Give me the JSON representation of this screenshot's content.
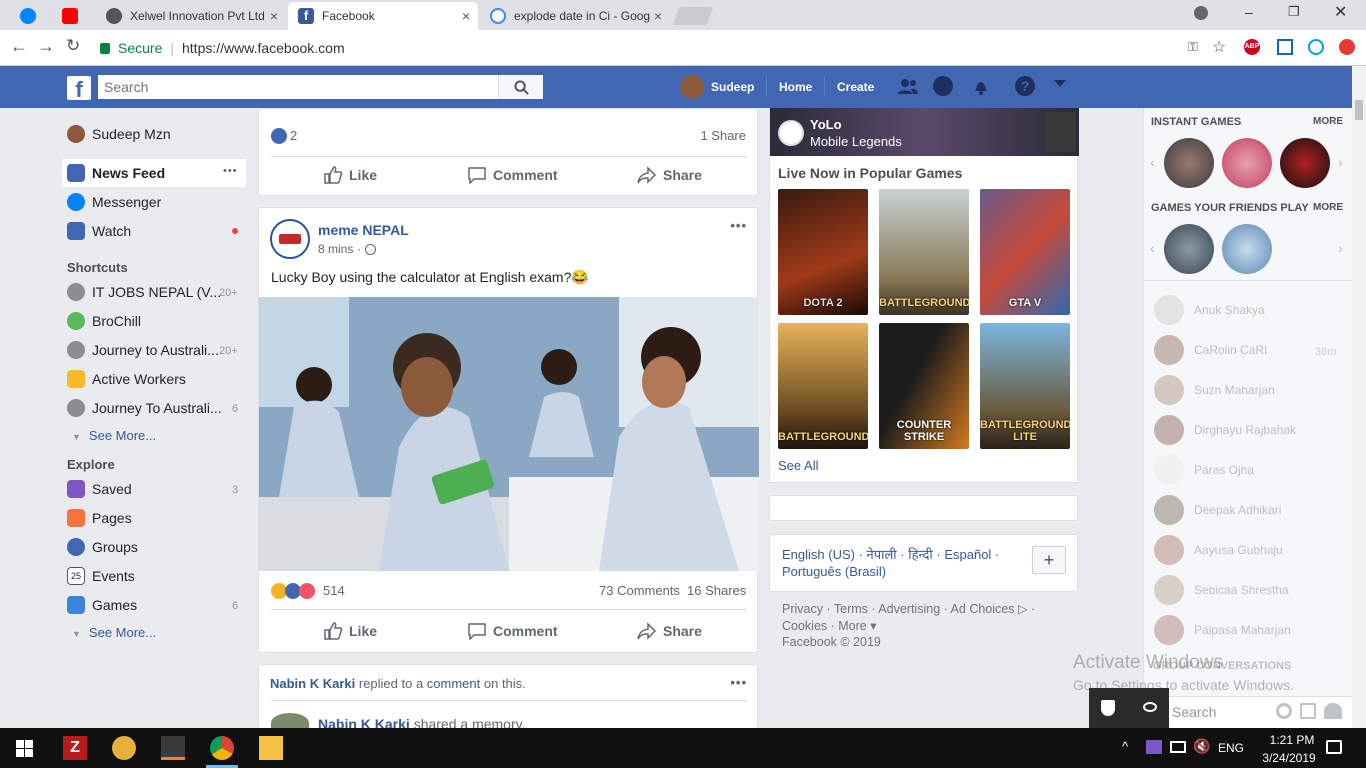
{
  "browser": {
    "tabs": [
      {
        "label": "",
        "icon": "messenger-icon"
      },
      {
        "label": "",
        "icon": "youtube-icon"
      },
      {
        "label": "Xelwel Innovation Pvt Ltd",
        "icon": "xelwel-icon"
      },
      {
        "label": "Facebook",
        "icon": "facebook-icon"
      },
      {
        "label": "explode date in Ci - Goog",
        "icon": "google-icon"
      }
    ],
    "secure_label": "Secure",
    "url": "https://www.facebook.com"
  },
  "header": {
    "search_placeholder": "Search",
    "user": "Sudeep",
    "home": "Home",
    "create": "Create"
  },
  "left_nav": {
    "profile": "Sudeep Mzn",
    "main": [
      {
        "label": "News Feed",
        "more": "•••"
      },
      {
        "label": "Messenger"
      },
      {
        "label": "Watch"
      }
    ],
    "shortcuts_title": "Shortcuts",
    "shortcuts": [
      {
        "label": "IT JOBS NEPAL (V...",
        "count": "20+"
      },
      {
        "label": "BroChill",
        "count": ""
      },
      {
        "label": "Journey to Australi...",
        "count": "20+"
      },
      {
        "label": "Active Workers",
        "count": ""
      },
      {
        "label": "Journey To Australi...",
        "count": "6"
      }
    ],
    "see_more": "See More...",
    "explore_title": "Explore",
    "explore": [
      {
        "label": "Saved",
        "count": "3"
      },
      {
        "label": "Pages",
        "count": ""
      },
      {
        "label": "Groups",
        "count": ""
      },
      {
        "label": "Events",
        "count": ""
      },
      {
        "label": "Games",
        "count": "6"
      }
    ],
    "see_more2": "See More..."
  },
  "feed": {
    "prev_post": {
      "reactions": "2",
      "shares": "1 Share"
    },
    "actions": {
      "like": "Like",
      "comment": "Comment",
      "share": "Share"
    },
    "post": {
      "author": "meme NEPAL",
      "time": "8 mins",
      "text": "Lucky Boy using the calculator at English exam?😂",
      "reactions": "514",
      "comments": "73 Comments",
      "shares": "16 Shares"
    },
    "next_post": {
      "actor": "Nabin K Karki",
      "middle": " replied to a ",
      "link": "comment",
      "end": " on this.",
      "author2": "Nabin K Karki",
      "shared": " shared a memory."
    }
  },
  "right_col": {
    "banner_title": "YoLo",
    "banner_sub": "Mobile Legends",
    "live_title": "Live Now in Popular Games",
    "games": [
      "DOTA 2",
      "BATTLEGROUNDS",
      "GTA V",
      "BATTLEGROUNDS",
      "COUNTER STRIKE",
      "BATTLEGROUNDS LITE"
    ],
    "see_all": "See All",
    "languages": "English (US) · नेपाली · हिन्दी · Español · Português (Brasil)",
    "footer_links": "Privacy · Terms · Advertising · Ad Choices ▷ · Cookies · More ▾",
    "copyright": "Facebook © 2019"
  },
  "chat": {
    "instant_games": "INSTANT GAMES",
    "more": "MORE",
    "friends_play": "GAMES YOUR FRIENDS PLAY",
    "more2": "MORE",
    "contacts": [
      {
        "name": "Anuk Shakya",
        "time": ""
      },
      {
        "name": "CaRolin CaRI",
        "time": "36m"
      },
      {
        "name": "Suzn Maharjan",
        "time": ""
      },
      {
        "name": "Dirghayu Rajbahak",
        "time": ""
      },
      {
        "name": "Paras Ojha",
        "time": ""
      },
      {
        "name": "Deepak Adhikari",
        "time": ""
      },
      {
        "name": "Aayusa Gubhaju",
        "time": ""
      },
      {
        "name": "Sebicaa Shrestha",
        "time": ""
      },
      {
        "name": "Palpasa Maharjan",
        "time": ""
      }
    ],
    "group_conv": "GROUP CONVERSATIONS",
    "search": "Search"
  },
  "watermark": {
    "line1": "Activate Windows",
    "line2": "Go to Settings to activate Windows."
  },
  "taskbar": {
    "time": "1:21 PM",
    "date": "3/24/2019",
    "lang": "ENG"
  }
}
